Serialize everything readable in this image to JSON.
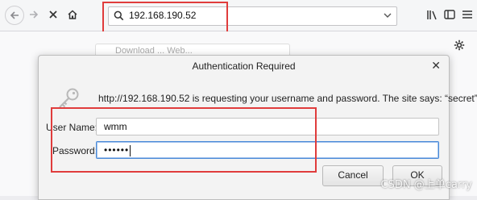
{
  "browser": {
    "url": "192.168.190.52"
  },
  "background_page": {
    "tab_text": "Download ... Web..."
  },
  "dialog": {
    "title": "Authentication Required",
    "message": "http://192.168.190.52 is requesting your username and password. The site says: “secret”",
    "username_label": "User Name:",
    "username_value": "wmm",
    "password_label": "Password:",
    "password_value": "••••••",
    "cancel_label": "Cancel",
    "ok_label": "OK"
  },
  "watermark": "CSDN @上单carry",
  "colors": {
    "annotation_red": "#e03c3c",
    "focus_blue": "#4a8ad8"
  }
}
